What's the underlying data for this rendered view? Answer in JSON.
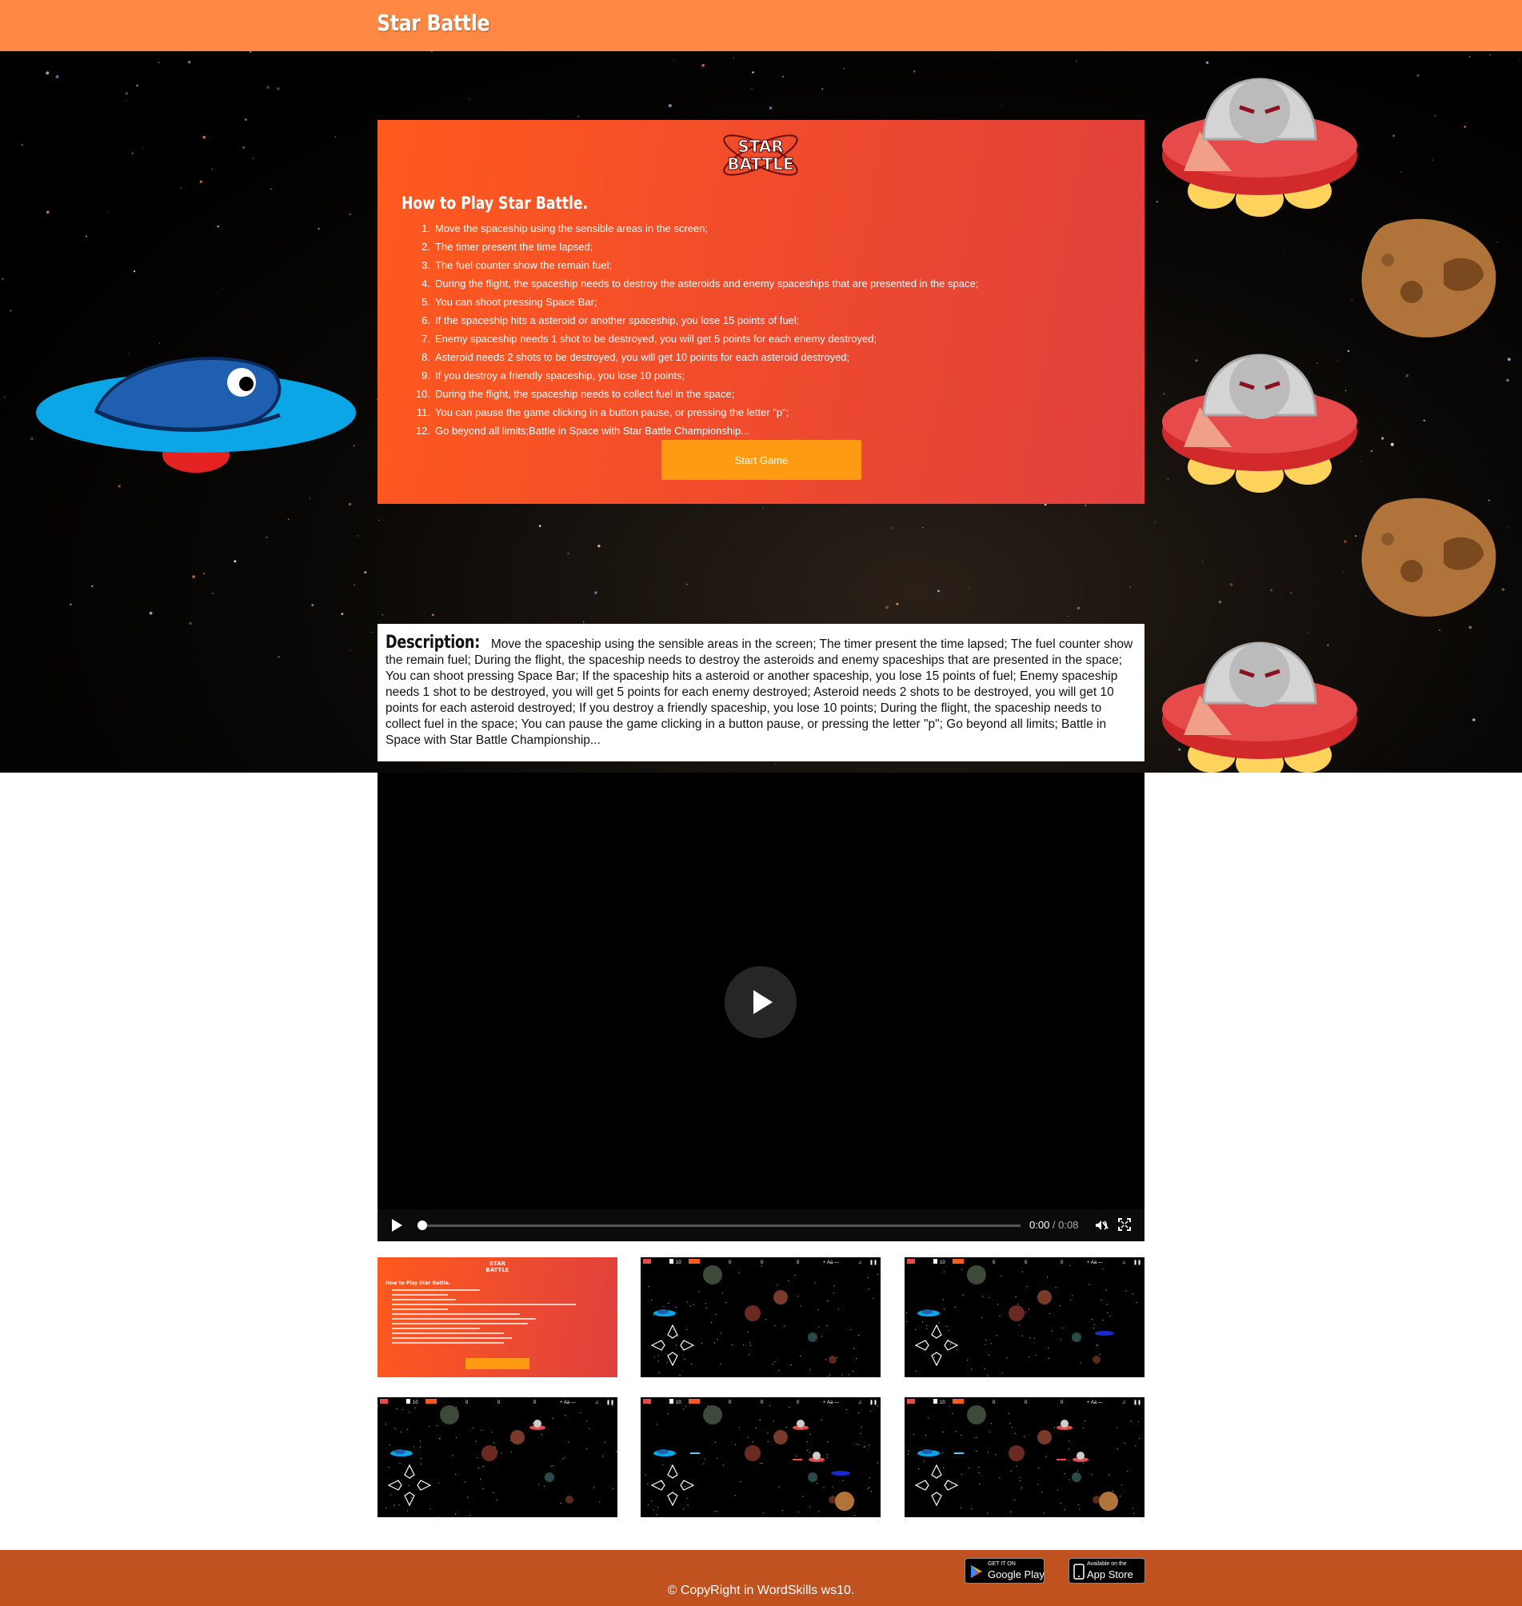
{
  "header": {
    "brand": "Star Battle"
  },
  "how_to": {
    "logo_line1": "STAR",
    "logo_line2": "BATTLE",
    "title": "How to Play Star Battle.",
    "rules": [
      "Move the spaceship using the sensible areas in the screen;",
      "The timer present the time lapsed;",
      "The fuel counter show the remain fuel;",
      "During the flight, the spaceship needs to destroy the asteroids and enemy spaceships that are presented in the space;",
      "You can shoot pressing Space Bar;",
      "If the spaceship hits a asteroid or another spaceship, you lose 15 points of fuel;",
      "Enemy spaceship needs 1 shot to be destroyed, you will get 5 points for each enemy destroyed;",
      "Asteroid needs 2 shots to be destroyed, you will get 10 points for each asteroid destroyed;",
      "If you destroy a friendly spaceship, you lose 10 points;",
      "During the flight, the spaceship needs to collect fuel in the space;",
      "You can pause the game clicking in a button pause, or pressing the letter \"p\";",
      "Go beyond all limits;Battle in Space with Star Battle Championship..."
    ],
    "start_button": "Start Game"
  },
  "description": {
    "label": "Description:",
    "text": "Move the spaceship using the sensible areas in the screen; The timer present the time lapsed; The fuel counter show the remain fuel; During the flight, the spaceship needs to destroy the asteroids and enemy spaceships that are presented in the space; You can shoot pressing Space Bar; If the spaceship hits a asteroid or another spaceship, you lose 15 points of fuel; Enemy spaceship needs 1 shot to be destroyed, you will get 5 points for each enemy destroyed; Asteroid needs 2 shots to be destroyed, you will get 10 points for each asteroid destroyed; If you destroy a friendly spaceship, you lose 10 points; During the flight, the spaceship needs to collect fuel in the space; You can pause the game clicking in a button pause, or pressing the letter \"p\"; Go beyond all limits; Battle in Space with Star Battle Championship..."
  },
  "video": {
    "current_time": "0:00",
    "separator": " / ",
    "duration": "0:08",
    "progress": 0
  },
  "screenshots": {
    "hud_score": "10",
    "hud_fuel": "0",
    "hud_time": "0",
    "hud_enemies": "0",
    "hud_font": "+ Aa —",
    "hud_sound": "♫",
    "hud_pause": "❚❚"
  },
  "footer": {
    "copyright": "© CopyRight in WordSkills ws10.",
    "google_small": "GET IT ON",
    "google_large": "Google Play",
    "apple_small": "Available on the",
    "apple_large": "App Store"
  },
  "colors": {
    "header": "#ff8845",
    "panel_start": "#ff5a1e",
    "panel_end": "#e0403e",
    "start_button": "#ff9b12",
    "footer": "#c0521f"
  },
  "icons": [
    "play-icon",
    "mute-icon",
    "fullscreen-icon",
    "google-play-icon",
    "apple-icon"
  ]
}
